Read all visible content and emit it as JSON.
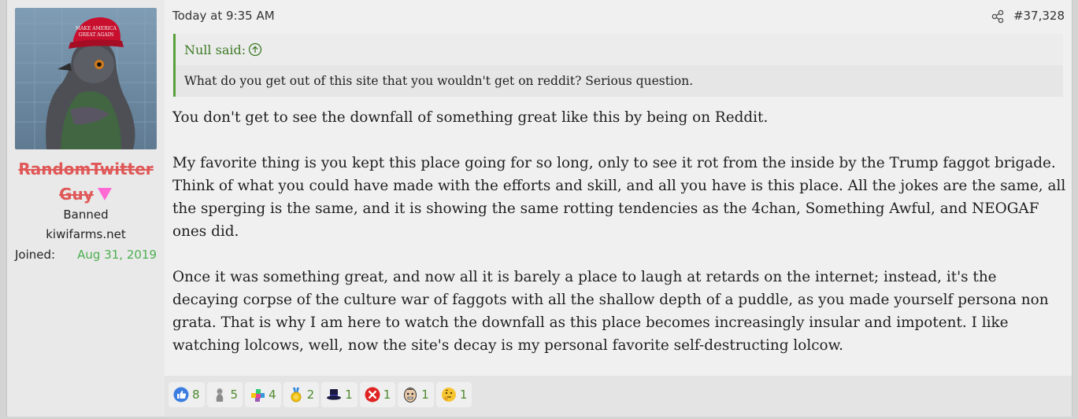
{
  "user": {
    "username_line1": "RandomTwitter",
    "username_line2": "Guy",
    "title": "Banned",
    "site": "kiwifarms.net",
    "joined_label": "Joined:",
    "joined_date": "Aug 31, 2019"
  },
  "post": {
    "date": "Today at 9:35 AM",
    "number": "#37,328"
  },
  "quote": {
    "author": "Null said:",
    "text": "What do you get out of this site that you wouldn't get on reddit? Serious question."
  },
  "message": {
    "paragraphs": [
      "You don't get to see the downfall of something great like this by being on Reddit.",
      "My favorite thing is you kept this place going for so long, only to see it rot from the inside by the Trump faggot brigade. Think of what you could have made with the efforts and skill, and all you have is this place. All the jokes are the same, all the sperging is the same, and it is showing the same rotting tendencies as the 4chan, Something Awful, and NEOGAF ones did.",
      "Once it was something great, and now all it is barely a place to laugh at retards on the internet; instead, it's the decaying corpse of the culture war of faggots with all the shallow depth of a puddle, as you made yourself persona non grata. That is why I am here to watch the downfall as this place becomes increasingly insular and impotent. I like watching lolcows, well, now the site's decay is my personal favorite self-destructing lolcow."
    ]
  },
  "reactions": [
    {
      "icon": "like-icon",
      "count": "8"
    },
    {
      "icon": "statue-icon",
      "count": "5"
    },
    {
      "icon": "puzzle-icon",
      "count": "4"
    },
    {
      "icon": "medal-icon",
      "count": "2"
    },
    {
      "icon": "top-hat-icon",
      "count": "1"
    },
    {
      "icon": "x-circle-icon",
      "count": "1"
    },
    {
      "icon": "face-icon",
      "count": "1"
    },
    {
      "icon": "thinking-icon",
      "count": "1"
    }
  ],
  "colors": {
    "username": "#e05757",
    "accent_green": "#4caf50",
    "quote_border": "#5aa03a"
  }
}
